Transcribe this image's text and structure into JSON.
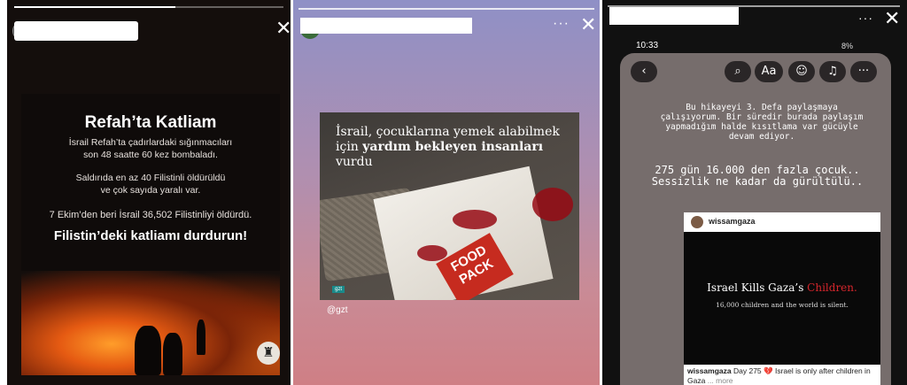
{
  "panels": {
    "story1": {
      "title": "Refah’ta Katliam",
      "line1": "İsrail Refah’ta çadırlardaki sığınmacıları",
      "line2": "son 48 saatte 60 kez bombaladı.",
      "line3": "Saldırıda en az 40 Filistinli öldürüldü",
      "line4": "ve çok sayıda yaralı var.",
      "line5": "7 Ekim’den beri İsrail 36,502 Filistinliyi öldürdü.",
      "callout": "Filistin’deki katliamı durdurun!",
      "close_glyph": "✕",
      "badge_glyph": "♜"
    },
    "story2": {
      "dots": "···",
      "close_glyph": "✕",
      "headline_part1": "İsrail, çocuklarına yemek alabilmek için ",
      "headline_bold1": "yardım bekleyen insanları",
      "headline_part2": " vurdu",
      "food_pack": "FOOD PACK",
      "watermark": "gzt",
      "caption": "@gzt"
    },
    "story3": {
      "dots": "···",
      "close_glyph": "✕",
      "time": "10:33",
      "battery": "8%",
      "toolbar": {
        "back": "‹",
        "mention": "⌕",
        "text": "Aa",
        "sticker": "☺",
        "music": "♫",
        "more": "···"
      },
      "message1": "Bu hikayeyi 3. Defa paylaşmaya çalışıyorum. Bir süredir burada paylaşım yapmadığım halde kısıtlama var gücüyle devam ediyor.",
      "message2": "275 gün 16.000 den fazla çocuk.. Sessizlik ne kadar da gürültülü..",
      "repost": {
        "username": "wissamgaza",
        "title_prefix": "Israel Kills Gaza’s ",
        "title_red": "Children.",
        "subtitle": "16,000 children and the world is silent.",
        "caption_user": "wissamgaza",
        "caption_text": " Day 275 💔 Israel is only after children in Gaza",
        "caption_more": "... more"
      }
    }
  }
}
